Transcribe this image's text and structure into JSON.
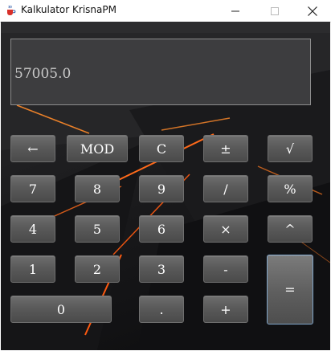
{
  "window": {
    "title": "Kalkulator KrisnaPM",
    "icons": [
      "java-cup-icon",
      "minimize-icon",
      "maximize-icon",
      "close-icon"
    ]
  },
  "display": {
    "value": "57005.0"
  },
  "buttons": {
    "backspace": "←",
    "mod": "MOD",
    "clear": "C",
    "plusminus": "±",
    "sqrt": "√",
    "seven": "7",
    "eight": "8",
    "nine": "9",
    "divide": "/",
    "percent": "%",
    "four": "4",
    "five": "5",
    "six": "6",
    "multiply": "×",
    "power": "^",
    "one": "1",
    "two": "2",
    "three": "3",
    "minus": "-",
    "equals": "=",
    "zero": "0",
    "decimal": ".",
    "plus": "+"
  },
  "colors": {
    "accent_orange": "#ff6a1a",
    "button_face": "#5a5a5a",
    "display_bg": "#3d3d3f"
  }
}
